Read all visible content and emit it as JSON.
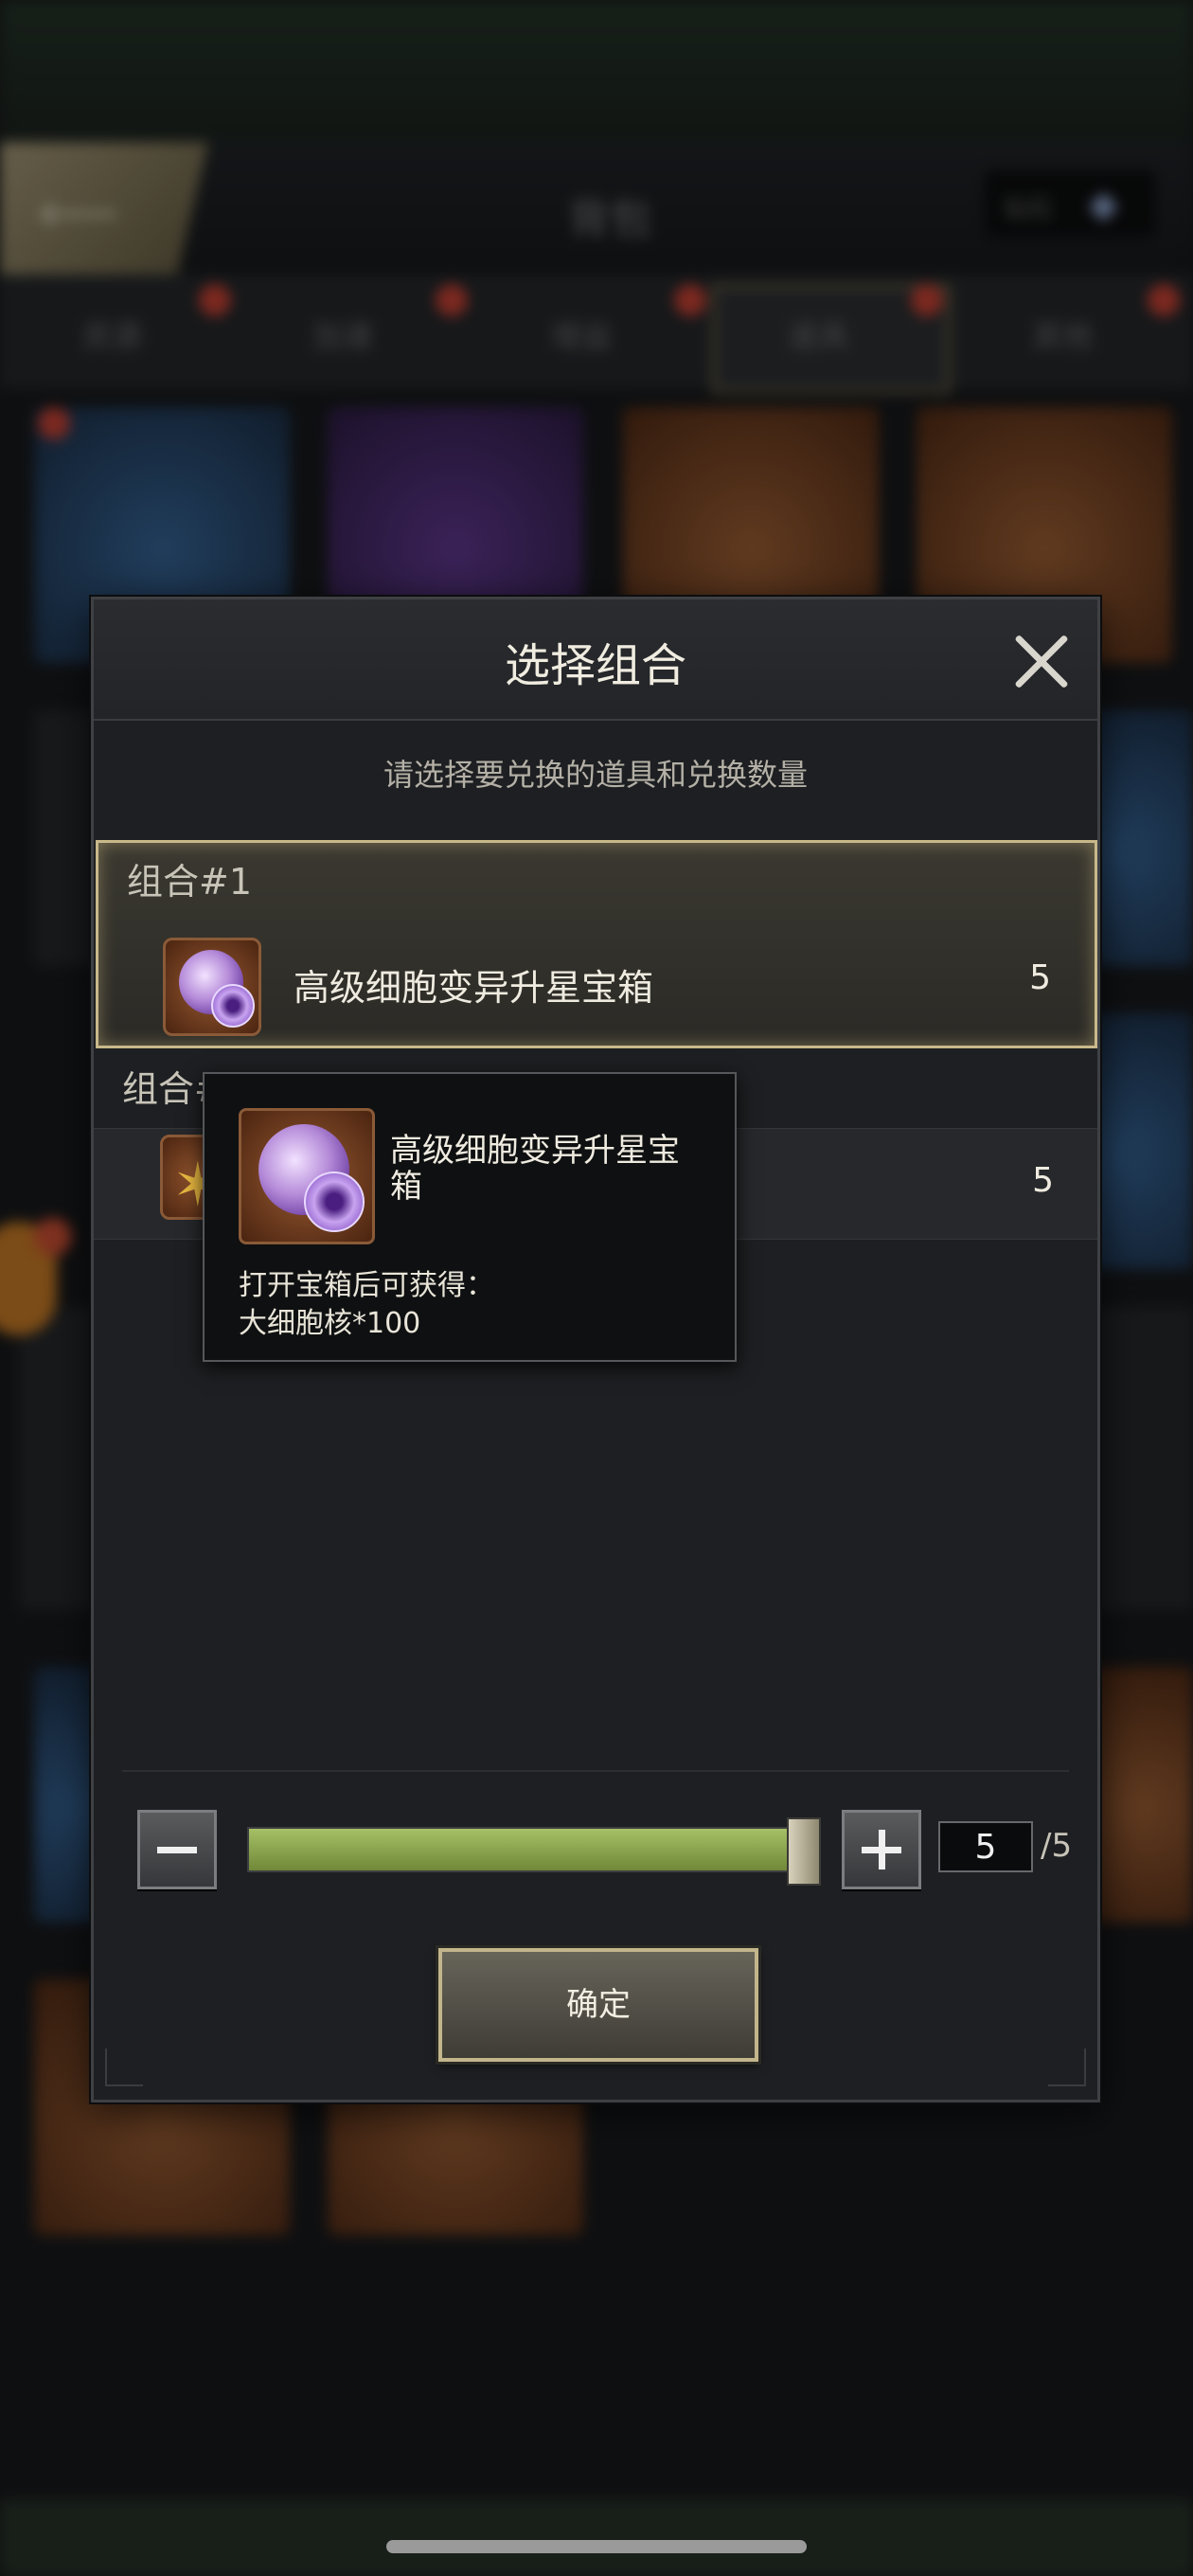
{
  "background": {
    "title": "背包",
    "gem_label": "钻石",
    "tabs": [
      "资源",
      "加速",
      "增益",
      "道具",
      "其他"
    ]
  },
  "dialog": {
    "title": "选择组合",
    "subtitle": "请选择要兑换的道具和兑换数量",
    "combos": [
      {
        "label": "组合#1",
        "item_name": "高级细胞变异升星宝箱",
        "count": "5",
        "selected": true
      },
      {
        "label": "组合#2",
        "item_name": "",
        "count": "5",
        "selected": false
      }
    ],
    "tooltip": {
      "name": "高级细胞变异升星宝箱",
      "desc_line1": "打开宝箱后可获得：",
      "desc_line2": "大细胞核*100"
    },
    "quantity": {
      "value": "5",
      "max_label": "/5",
      "fill_fraction": 1.0
    },
    "confirm_label": "确定"
  }
}
